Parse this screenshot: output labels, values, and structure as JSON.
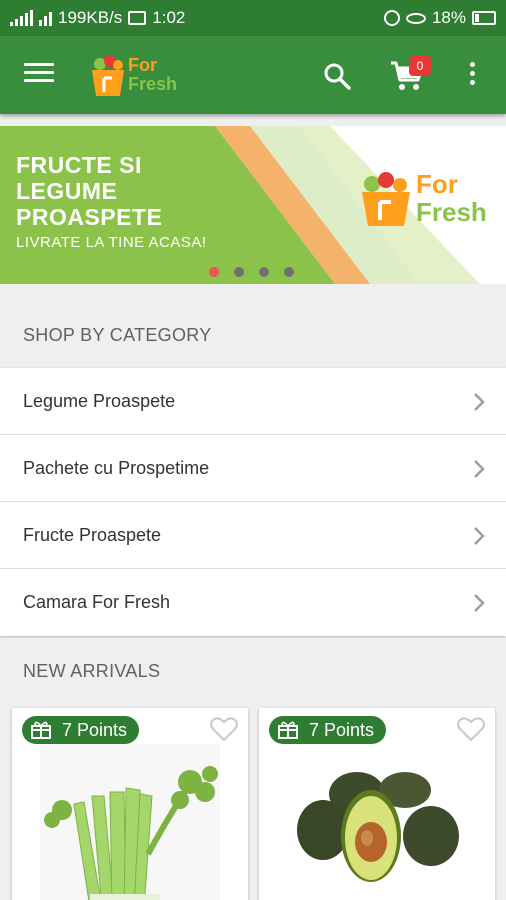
{
  "status_bar": {
    "network_speed": "199KB/s",
    "time": "1:02",
    "battery": "18%"
  },
  "app_bar": {
    "menu_icon": "menu-icon",
    "logo_line1": "For",
    "logo_line2": "Fresh",
    "search_icon": "search-icon",
    "cart_icon": "cart-icon",
    "cart_count": "0",
    "more_icon": "more-vert-icon"
  },
  "banner": {
    "headline": "FRUCTE SI LEGUME PROASPETE",
    "subline": "LIVRATE LA TINE ACASA!",
    "logo_line1": "For",
    "logo_line2": "Fresh",
    "active_slide": 1,
    "slide_count": 4
  },
  "categories": {
    "header": "SHOP BY CATEGORY",
    "items": [
      {
        "label": "Legume Proaspete"
      },
      {
        "label": "Pachete cu Prospetime"
      },
      {
        "label": "Fructe Proaspete"
      },
      {
        "label": "Camara For Fresh"
      }
    ]
  },
  "new_arrivals": {
    "header": "NEW ARRIVALS",
    "products": [
      {
        "points": "7 Points",
        "image": "celery"
      },
      {
        "points": "7 Points",
        "image": "avocado"
      }
    ]
  },
  "colors": {
    "primary": "#388e3c",
    "primary_dark": "#2e7d32",
    "accent_orange": "#ff9f1c",
    "accent_green": "#8bc34a",
    "badge_red": "#e53935"
  }
}
